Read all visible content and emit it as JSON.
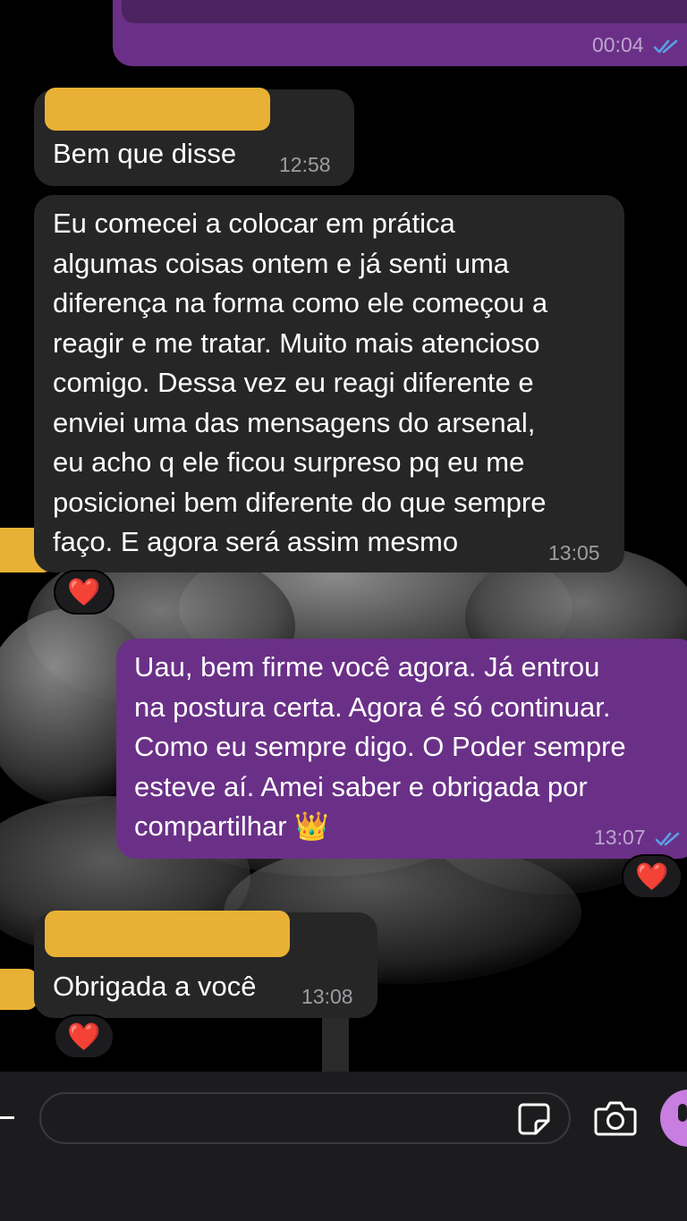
{
  "chat": {
    "messages": [
      {
        "direction": "outgoing",
        "time": "00:04",
        "status": "read"
      },
      {
        "direction": "incoming",
        "text": "Bem que disse",
        "time": "12:58",
        "sender_redacted": true
      },
      {
        "direction": "incoming",
        "text": "Eu comecei a colocar em prática\nalgumas coisas ontem e já senti uma\ndiferença na forma como ele começou a\nreagir e me tratar. Muito mais atencioso\ncomigo. Dessa vez eu reagi diferente e\nenviei uma das mensagens do arsenal,\neu acho q ele ficou surpreso pq eu me\nposicionei bem diferente do que sempre\nfaço. E agora será assim mesmo",
        "time": "13:05",
        "reaction": "❤️"
      },
      {
        "direction": "outgoing",
        "text": "Uau, bem firme você agora. Já entrou\nna postura certa. Agora é só continuar.\nComo eu sempre digo. O Poder sempre\nesteve aí. Amei saber e obrigada por\ncompartilhar 👑",
        "time": "13:07",
        "status": "read",
        "reaction": "❤️"
      },
      {
        "direction": "incoming",
        "text": "Obrigada a você",
        "time": "13:08",
        "sender_redacted": true,
        "reaction": "❤️"
      }
    ]
  },
  "icons": [
    "plus-icon",
    "sticker-icon",
    "camera-icon",
    "microphone-icon",
    "double-check-icon",
    "heart-reaction-icon"
  ],
  "colors": {
    "background": "#000000",
    "incoming_bubble": "#262626",
    "outgoing_bubble": "#6a3087",
    "redaction": "#e8b135",
    "read_check": "#5aa0e6",
    "mic_button": "#c77ee0"
  }
}
